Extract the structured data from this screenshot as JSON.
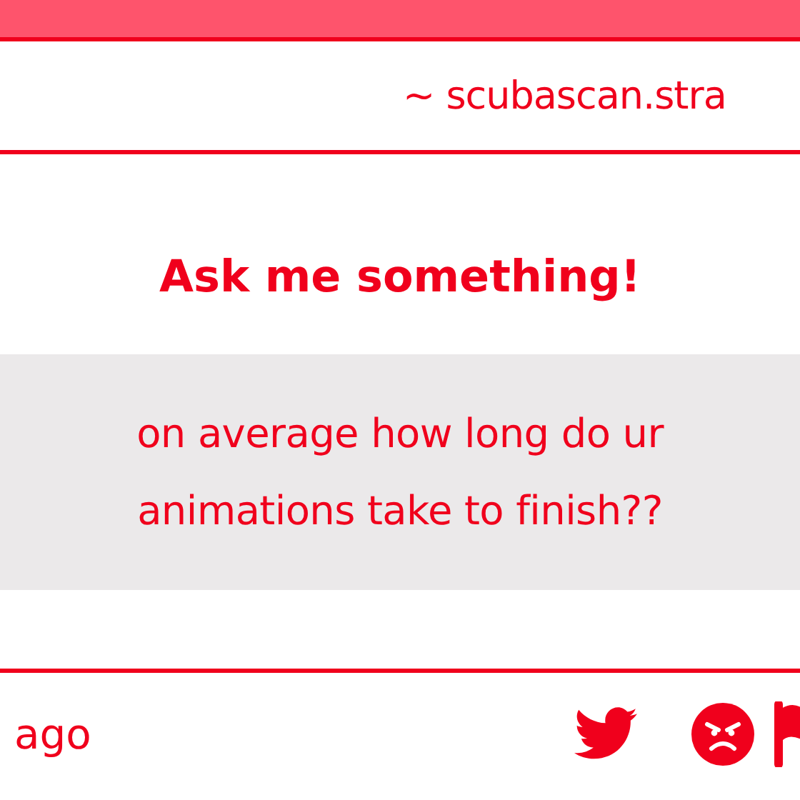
{
  "header": {
    "site": "~ scubascan.stra"
  },
  "title": "Ask me something!",
  "question": "on average how long do ur animations take to finish??",
  "footer": {
    "time": "ago"
  }
}
